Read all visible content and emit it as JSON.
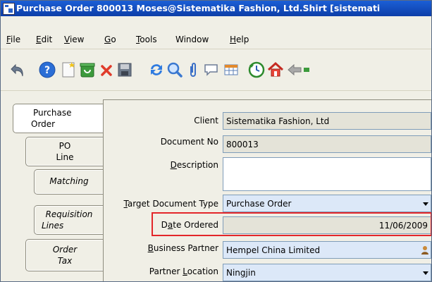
{
  "window": {
    "title": "Purchase Order  800013  Moses@Sistematika Fashion, Ltd.Shirt [sistemati"
  },
  "menu": [
    {
      "label": "File",
      "name": "menu-file"
    },
    {
      "label": "Edit",
      "name": "menu-edit"
    },
    {
      "label": "View",
      "name": "menu-view"
    },
    {
      "label": "Go",
      "name": "menu-go"
    },
    {
      "label": "Tools",
      "name": "menu-tools"
    },
    {
      "label": "Window",
      "name": "menu-window"
    },
    {
      "label": "Help",
      "name": "menu-help"
    }
  ],
  "toolbar": [
    "undo-icon",
    "help-icon",
    "new-record-icon",
    "copy-record-icon",
    "delete-icon",
    "save-icon",
    "refresh-icon",
    "find-icon",
    "attachment-icon",
    "chat-icon",
    "grid-toggle-icon",
    "history-icon",
    "home-icon",
    "back-icon"
  ],
  "tabs": [
    {
      "line1": "Purchase",
      "line2": "Order",
      "active": true
    },
    {
      "line1": "PO",
      "line2": "Line"
    },
    {
      "line1": "Matching",
      "line2": ""
    },
    {
      "line1": "Requisition",
      "line2": "Lines"
    },
    {
      "line1": "Order",
      "line2": "Tax"
    }
  ],
  "form": {
    "client": {
      "label": "Client",
      "value": "Sistematika Fashion, Ltd"
    },
    "document_no": {
      "label": "Document No",
      "value": "800013"
    },
    "description": {
      "label": "Description",
      "value": ""
    },
    "target_document_type": {
      "label": "Target Document Type",
      "value": "Purchase Order"
    },
    "date_ordered": {
      "label": "Date Ordered",
      "value": "11/06/2009"
    },
    "business_partner": {
      "label": "Business Partner",
      "value": "Hempel China Limited"
    },
    "partner_location": {
      "label": "Partner Location",
      "value": "Ningjin"
    }
  },
  "colors": {
    "titlebar": "#0d3ea8",
    "highlight": "#e3262a",
    "required_field": "#dce8f8",
    "readonly_field": "#e4e3d8"
  }
}
